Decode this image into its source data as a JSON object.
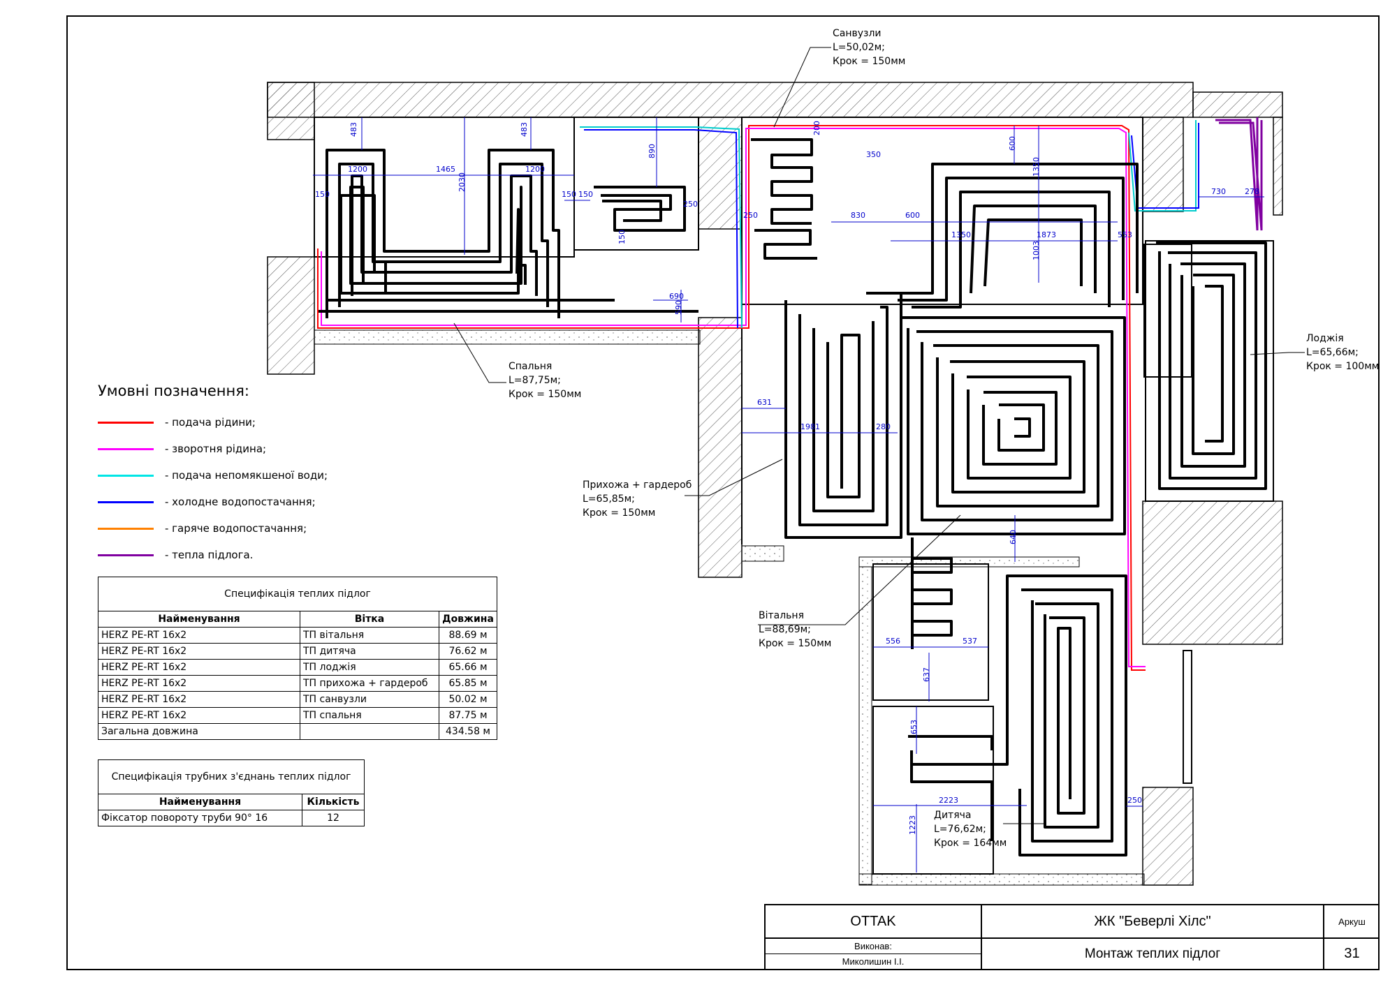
{
  "rooms": {
    "sanvuzly": [
      "Санвузли",
      "L=50,02м;",
      "Крок = 150мм"
    ],
    "spalnia": [
      "Спальня",
      "L=87,75м;",
      "Крок = 150мм"
    ],
    "lodzhia": [
      "Лоджія",
      "L=65,66м;",
      "Крок = 100мм"
    ],
    "prykhozha": [
      "Прихожа + гардероб",
      "L=65,85м;",
      "Крок = 150мм"
    ],
    "vitalnia": [
      "Вітальня",
      "L=88,69м;",
      "Крок = 150мм"
    ],
    "dytiacha": [
      "Дитяча",
      "L=76,62м;",
      "Крок = 164мм"
    ]
  },
  "dims": [
    "483",
    "1200",
    "1465",
    "2030",
    "483",
    "1200",
    "150",
    "150",
    "150",
    "890",
    "250",
    "150",
    "690",
    "590",
    "200",
    "350",
    "250",
    "830",
    "600",
    "600",
    "1350",
    "1350",
    "1873",
    "553",
    "1003",
    "730",
    "278",
    "631",
    "1981",
    "280",
    "640",
    "556",
    "537",
    "637",
    "653",
    "2223",
    "1223",
    "250"
  ],
  "legend": {
    "title": "Умовні позначення:",
    "items": [
      {
        "label": "- подача рідини;",
        "color": "#ff0000"
      },
      {
        "label": "- зворотня рідина;",
        "color": "#ff00ff"
      },
      {
        "label": "- подача непомякшеної води;",
        "color": "#00e5e5"
      },
      {
        "label": "- холодне водопостачання;",
        "color": "#0000ff"
      },
      {
        "label": "- гаряче водопостачання;",
        "color": "#ff8000"
      },
      {
        "label": "- тепла підлога.",
        "color": "#8000a0"
      }
    ]
  },
  "spec": {
    "title": "Специфікація теплих підлог",
    "headers": [
      "Найменування",
      "Вітка",
      "Довжина"
    ],
    "rows": [
      [
        "HERZ PE-RT 16x2",
        "ТП вітальня",
        "88.69 м"
      ],
      [
        "HERZ PE-RT 16x2",
        "ТП дитяча",
        "76.62 м"
      ],
      [
        "HERZ PE-RT 16x2",
        "ТП лоджія",
        "65.66 м"
      ],
      [
        "HERZ PE-RT 16x2",
        "ТП прихожа + гардероб",
        "65.85 м"
      ],
      [
        "HERZ PE-RT 16x2",
        "ТП санвузли",
        "50.02 м"
      ],
      [
        "HERZ PE-RT 16x2",
        "ТП спальня",
        "87.75 м"
      ]
    ],
    "total_label": "Загальна довжина",
    "total_value": "434.58 м"
  },
  "spec2": {
    "title": "Специфікація трубних з'єднань теплих підлог",
    "headers": [
      "Найменування",
      "Кількість"
    ],
    "rows": [
      [
        "Фіксатор повороту труби 90° 16",
        "12"
      ]
    ]
  },
  "title_block": {
    "company": "OTTAK",
    "project": "ЖК \"Беверлі Хілс\"",
    "sheet_label": "Аркуш",
    "performed_label": "Виконав:",
    "performer": "Миколишин І.І.",
    "drawing_title": "Монтаж теплих підлог",
    "sheet_number": "31"
  },
  "colors": {
    "pipe": "#000000",
    "pipe_core": "#6a0080",
    "dimension": "#0000cc",
    "hatch": "#555555"
  }
}
